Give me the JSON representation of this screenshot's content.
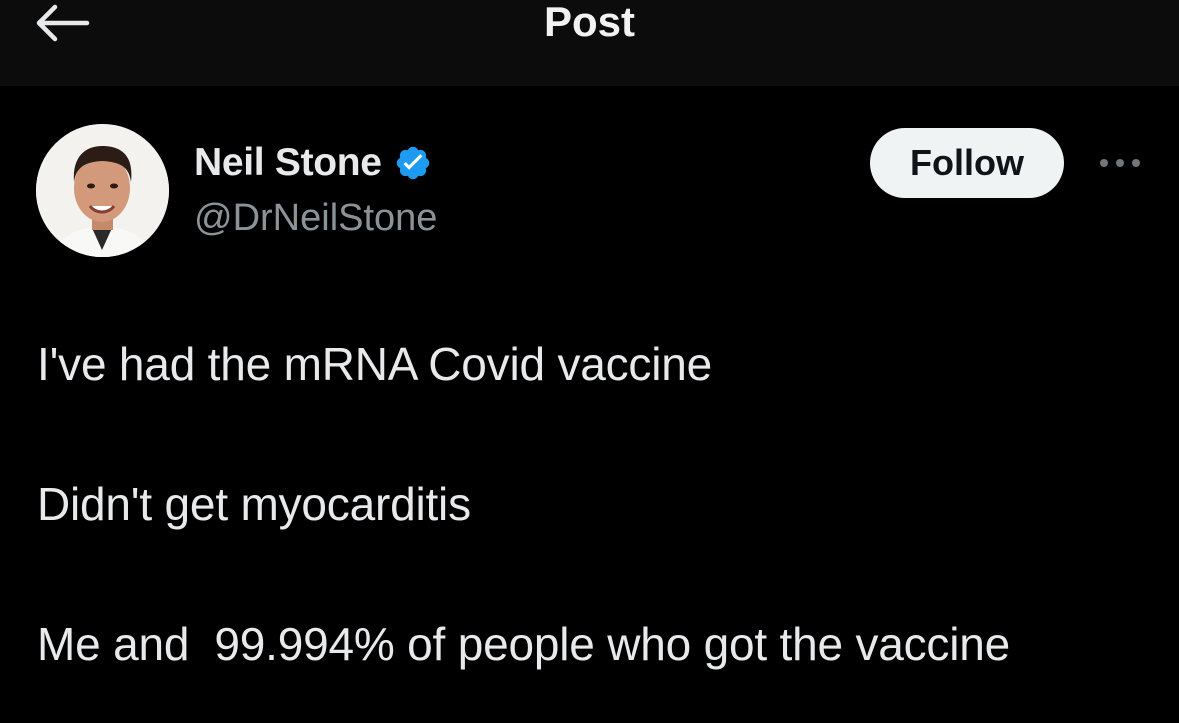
{
  "header": {
    "title": "Post",
    "back_icon": "arrow-left-icon"
  },
  "author": {
    "name": "Neil Stone",
    "handle": "@DrNeilStone",
    "verified_icon": "verified-badge-icon",
    "verified_color": "#1d9bf0"
  },
  "actions": {
    "follow_label": "Follow",
    "more_icon": "more-options-icon"
  },
  "tweet": {
    "lines": [
      "I've had the mRNA Covid vaccine",
      "Didn't get myocarditis",
      "Me and  99.994% of people who got the vaccine"
    ]
  },
  "colors": {
    "background": "#000000",
    "header_background": "#0c0c0c",
    "text_primary": "#e7e9ea",
    "text_secondary": "#8b9298",
    "follow_button_bg": "#eff3f4"
  }
}
